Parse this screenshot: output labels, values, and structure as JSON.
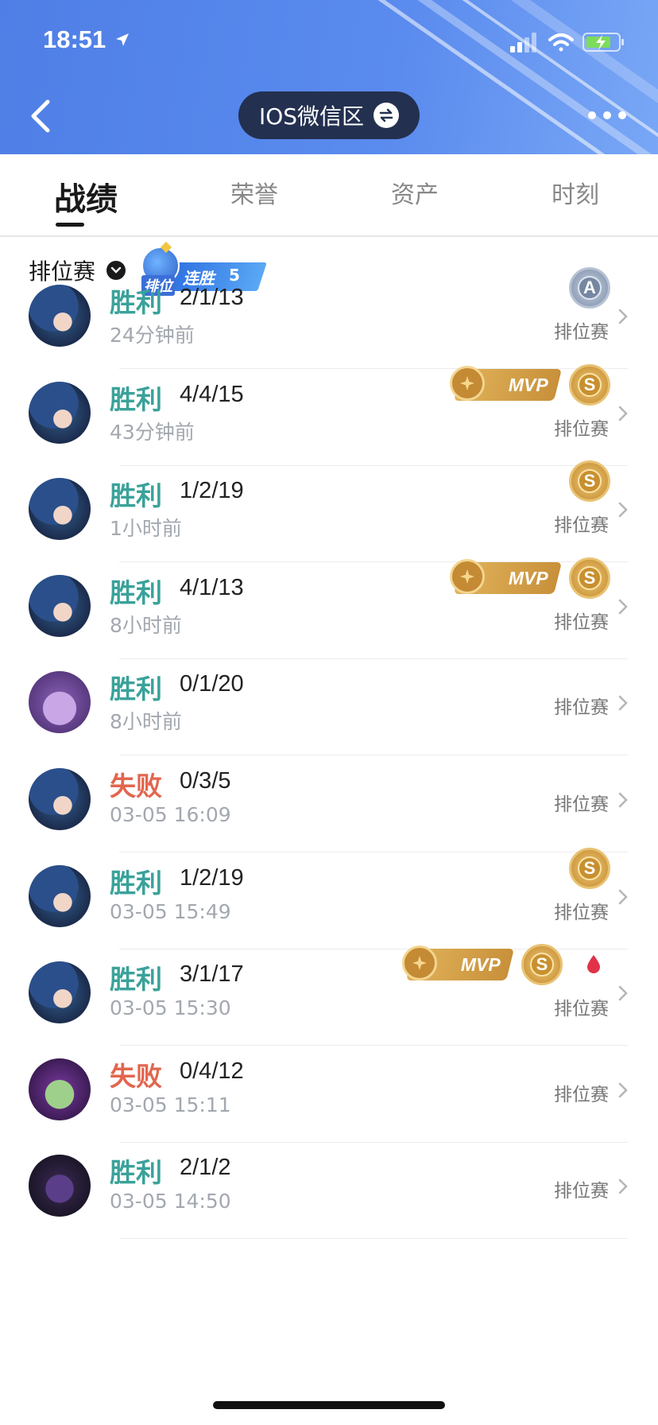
{
  "status_bar": {
    "time": "18:51"
  },
  "header": {
    "region": "IOS微信区"
  },
  "tabs": [
    {
      "label": "战绩",
      "active": true
    },
    {
      "label": "荣誉",
      "active": false
    },
    {
      "label": "资产",
      "active": false
    },
    {
      "label": "时刻",
      "active": false
    }
  ],
  "filter": {
    "label": "排位赛"
  },
  "streak_badge": {
    "tag": "排位",
    "label": "连胜",
    "count": "5"
  },
  "colors": {
    "win": "#3aa29a",
    "lose": "#e2664e",
    "header_blue": "#4f7fe6"
  },
  "matches": [
    {
      "result": "胜利",
      "win": true,
      "kda": "2/1/13",
      "time": "24分钟前",
      "mode": "排位赛",
      "grade": "A",
      "mvp": false,
      "blood": false,
      "avatar": "hero-blue"
    },
    {
      "result": "胜利",
      "win": true,
      "kda": "4/4/15",
      "time": "43分钟前",
      "mode": "排位赛",
      "grade": "S",
      "mvp": true,
      "blood": false,
      "avatar": "hero-blue"
    },
    {
      "result": "胜利",
      "win": true,
      "kda": "1/2/19",
      "time": "1小时前",
      "mode": "排位赛",
      "grade": "S",
      "mvp": false,
      "blood": false,
      "avatar": "hero-blue"
    },
    {
      "result": "胜利",
      "win": true,
      "kda": "4/1/13",
      "time": "8小时前",
      "mode": "排位赛",
      "grade": "S",
      "mvp": true,
      "blood": false,
      "avatar": "hero-blue"
    },
    {
      "result": "胜利",
      "win": true,
      "kda": "0/1/20",
      "time": "8小时前",
      "mode": "排位赛",
      "grade": "",
      "mvp": false,
      "blood": false,
      "avatar": "hero-purple"
    },
    {
      "result": "失败",
      "win": false,
      "kda": "0/3/5",
      "time": "03-05 16:09",
      "mode": "排位赛",
      "grade": "",
      "mvp": false,
      "blood": false,
      "avatar": "hero-blue"
    },
    {
      "result": "胜利",
      "win": true,
      "kda": "1/2/19",
      "time": "03-05 15:49",
      "mode": "排位赛",
      "grade": "S",
      "mvp": false,
      "blood": false,
      "avatar": "hero-blue"
    },
    {
      "result": "胜利",
      "win": true,
      "kda": "3/1/17",
      "time": "03-05 15:30",
      "mode": "排位赛",
      "grade": "S",
      "mvp": true,
      "blood": true,
      "avatar": "hero-blue"
    },
    {
      "result": "失败",
      "win": false,
      "kda": "0/4/12",
      "time": "03-05 15:11",
      "mode": "排位赛",
      "grade": "",
      "mvp": false,
      "blood": false,
      "avatar": "hero-green"
    },
    {
      "result": "胜利",
      "win": true,
      "kda": "2/1/2",
      "time": "03-05 14:50",
      "mode": "排位赛",
      "grade": "",
      "mvp": false,
      "blood": false,
      "avatar": "hero-dark"
    }
  ]
}
